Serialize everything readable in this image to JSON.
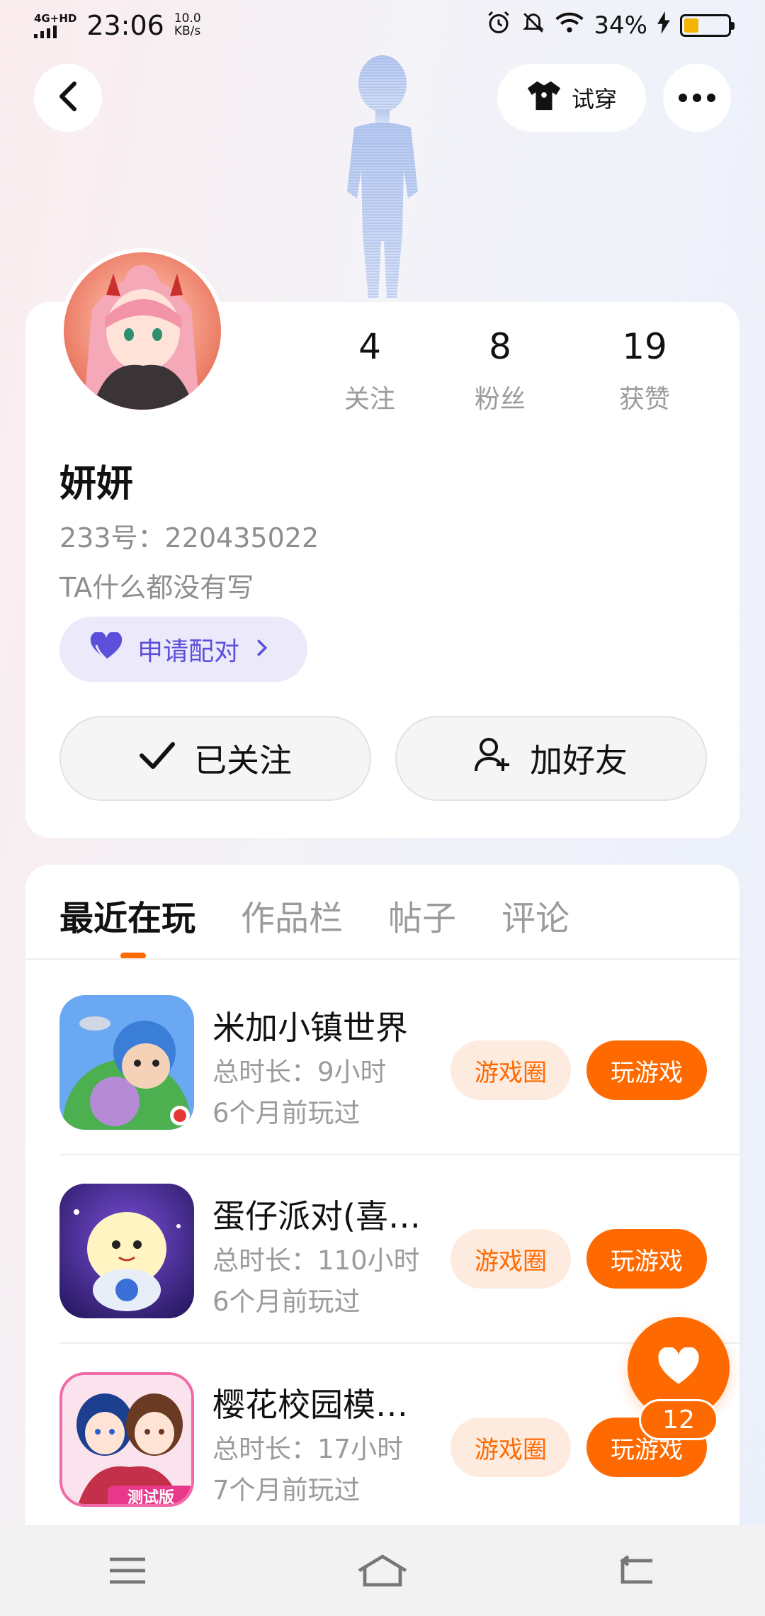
{
  "status_bar": {
    "network": "4G+HD",
    "time": "23:06",
    "speed_value": "10.0",
    "speed_unit": "KB/s",
    "battery_percent": "34%"
  },
  "nav": {
    "tryon_label": "试穿"
  },
  "profile": {
    "stats": [
      {
        "num": "4",
        "label": "关注"
      },
      {
        "num": "8",
        "label": "粉丝"
      },
      {
        "num": "19",
        "label": "获赞"
      }
    ],
    "name": "妍妍",
    "id_text": "233号：220435022",
    "bio": "TA什么都没有写",
    "match_label": "申请配对",
    "followed_label": "已关注",
    "add_friend_label": "加好友"
  },
  "tabs": [
    "最近在玩",
    "作品栏",
    "帖子",
    "评论"
  ],
  "games": [
    {
      "title": "米加小镇世界",
      "time": "总时长：9小时",
      "last": "6个月前玩过",
      "circle_label": "游戏圈",
      "play_label": "玩游戏"
    },
    {
      "title": "蛋仔派对(喜…",
      "time": "总时长：110小时",
      "last": "6个月前玩过",
      "circle_label": "游戏圈",
      "play_label": "玩游戏"
    },
    {
      "title": "樱花校园模…",
      "time": "总时长：17小时",
      "last": "7个月前玩过",
      "circle_label": "游戏圈",
      "play_label": "玩游戏"
    }
  ],
  "game3_badge": "测试版",
  "like": {
    "count": "12"
  },
  "colors": {
    "accent": "#ff6a00",
    "purple": "#5c4fd9",
    "purple_bg": "#ece9fb"
  },
  "icons": {
    "back": "chevron-left-icon",
    "tryon": "shirt-icon",
    "more": "more-dots-icon",
    "match": "heart-icon",
    "followed": "check-icon",
    "add_friend": "add-user-icon",
    "like": "heart-icon",
    "nav_menu": "menu-icon",
    "nav_home": "home-icon",
    "nav_back": "back-icon"
  }
}
